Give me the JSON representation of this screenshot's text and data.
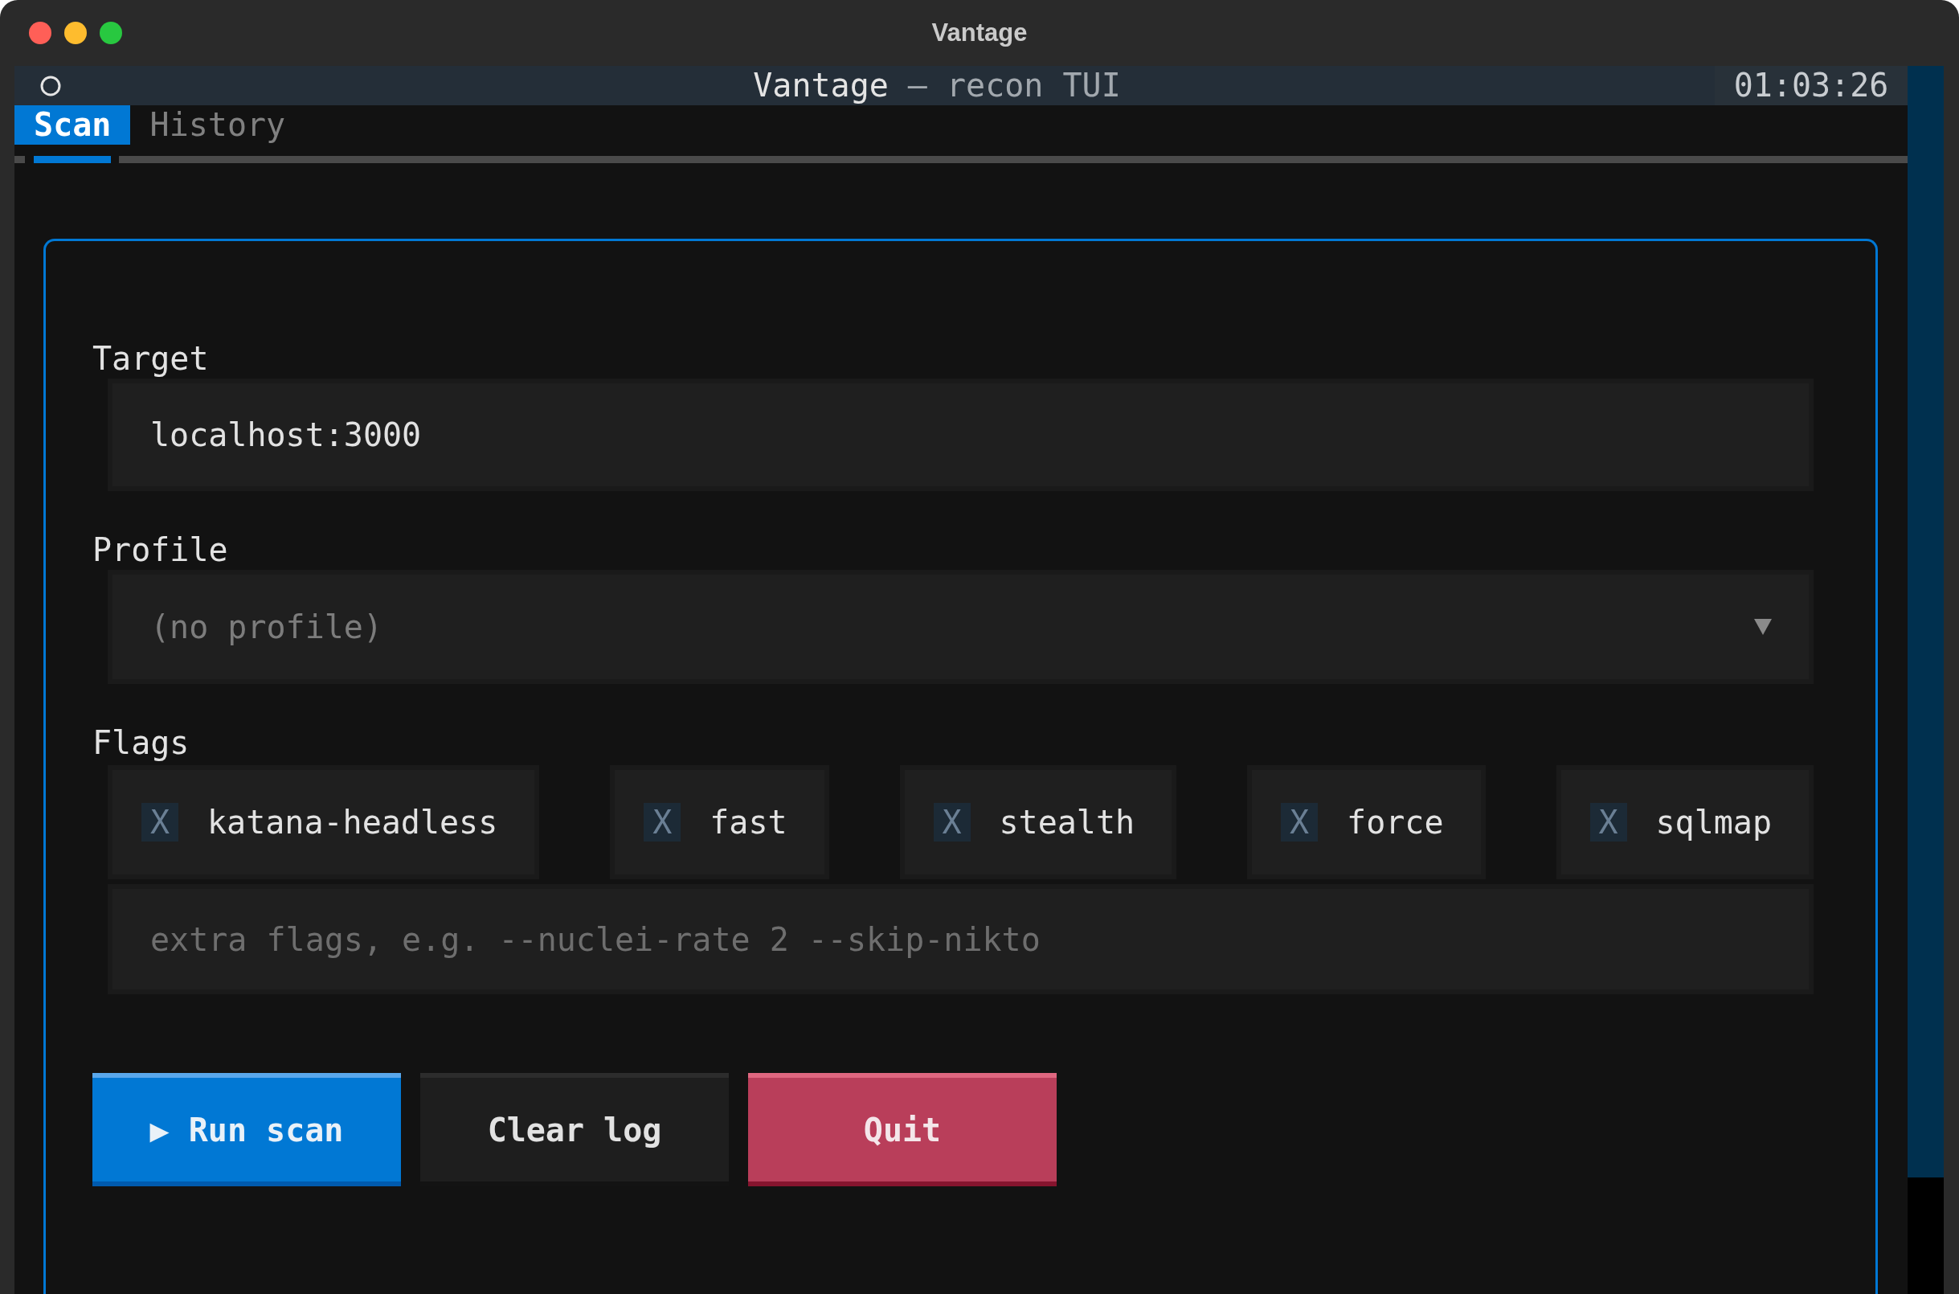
{
  "window": {
    "title": "Vantage"
  },
  "header": {
    "title": "Vantage",
    "subtitle": "— recon TUI",
    "clock": "01:03:26"
  },
  "tabs": [
    {
      "label": "Scan",
      "selected": true
    },
    {
      "label": "History",
      "selected": false
    }
  ],
  "form": {
    "target": {
      "label": "Target",
      "value": "localhost:3000"
    },
    "profile": {
      "label": "Profile",
      "placeholder": "(no profile)"
    },
    "flags": {
      "label": "Flags",
      "options": [
        {
          "glyph": "X",
          "label": "katana-headless",
          "checked": false
        },
        {
          "glyph": "X",
          "label": "fast",
          "checked": false
        },
        {
          "glyph": "X",
          "label": "stealth",
          "checked": false
        },
        {
          "glyph": "X",
          "label": "force",
          "checked": false
        },
        {
          "glyph": "X",
          "label": "sqlmap",
          "checked": false
        }
      ],
      "extra": {
        "placeholder": "extra flags, e.g. --nuclei-rate 2 --skip-nikto"
      }
    }
  },
  "buttons": [
    {
      "kind": "primary",
      "label": "▶ Run scan"
    },
    {
      "kind": "default",
      "label": "Clear log"
    },
    {
      "kind": "error",
      "label": "Quit"
    }
  ]
}
